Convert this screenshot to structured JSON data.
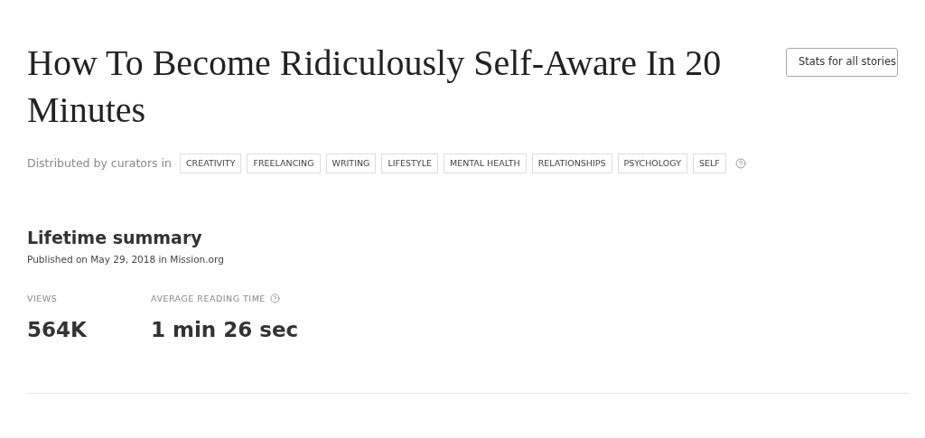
{
  "title": "How To Become Ridiculously Self-Aware In 20 Minutes",
  "stats_button": "Stats for all stories",
  "distribution": {
    "label": "Distributed by curators in",
    "tags": [
      "CREATIVITY",
      "FREELANCING",
      "WRITING",
      "LIFESTYLE",
      "MENTAL HEALTH",
      "RELATIONSHIPS",
      "PSYCHOLOGY",
      "SELF"
    ]
  },
  "summary": {
    "heading": "Lifetime summary",
    "published": "Published on May 29, 2018 in Mission.org",
    "metrics": [
      {
        "label": "VIEWS",
        "value": "564K",
        "help": false
      },
      {
        "label": "AVERAGE READING TIME",
        "value": "1 min 26 sec",
        "help": true
      }
    ]
  }
}
